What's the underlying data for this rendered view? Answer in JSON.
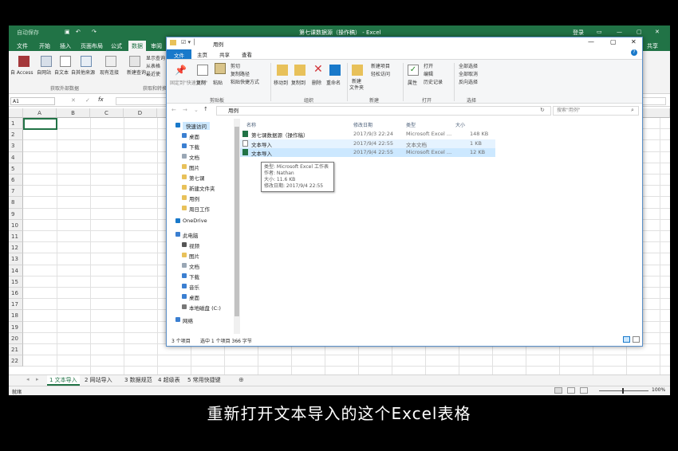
{
  "excel": {
    "qat_label": "自动保存",
    "title": "第七课数据源（操作稿） - Excel",
    "user": "登录",
    "share": "共享",
    "tabs": [
      "文件",
      "开始",
      "插入",
      "页面布局",
      "公式",
      "数据",
      "审阅"
    ],
    "active_tab": "数据",
    "ribbon": {
      "access": "自 Access",
      "web": "自网站",
      "text": "自文本",
      "other": "自其他来源",
      "existing": "现有连接",
      "new_query": "新建查询",
      "show_queries": "显示查询",
      "from_table": "从表格",
      "recent": "最近使",
      "group_external": "获取外部数据",
      "group_transform": "获取和转换"
    },
    "namebox": "A1",
    "formula_icons": [
      "✕",
      "✓",
      "fx"
    ],
    "columns": [
      "A",
      "B",
      "C",
      "D"
    ],
    "rows": [
      "1",
      "2",
      "3",
      "4",
      "5",
      "6",
      "7",
      "8",
      "9",
      "10",
      "11",
      "12",
      "13",
      "14",
      "15",
      "16",
      "17",
      "18",
      "19",
      "20",
      "21",
      "22"
    ],
    "sheets": [
      "1 文本导入",
      "2 网站导入",
      "3 数据规范",
      "4 超级表",
      "5 常用快捷键"
    ],
    "active_sheet": "1 文本导入",
    "status": "就绪",
    "zoom": "100%"
  },
  "explorer": {
    "title": "用例",
    "tabs": [
      "文件",
      "主页",
      "共享",
      "查看"
    ],
    "active_tab": "主页",
    "ribbon": {
      "pin": "固定到\"快速访问\"",
      "copy": "复制",
      "paste": "粘贴",
      "cut": "剪切",
      "copy_path": "复制路径",
      "paste_shortcut": "粘贴快捷方式",
      "move_to": "移动到",
      "copy_to": "复制到",
      "delete": "删除",
      "rename": "重命名",
      "new_folder": "新建\n文件夹",
      "new_item": "新建项目",
      "easy_access": "轻松访问",
      "properties": "属性",
      "open": "打开",
      "edit": "编辑",
      "history": "历史记录",
      "select_all": "全部选择",
      "select_none": "全部取消",
      "invert": "反向选择",
      "group_clipboard": "剪贴板",
      "group_organize": "组织",
      "group_new": "新建",
      "group_open": "打开",
      "group_select": "选择"
    },
    "address": "用例",
    "search_placeholder": "搜索\"用例\"",
    "nav": {
      "quick_access": "快速访问",
      "items": [
        "桌面",
        "下载",
        "文档",
        "图片",
        "第七课",
        "新建文件夹",
        "用例",
        "周日工作"
      ],
      "onedrive": "OneDrive",
      "this_pc": "此电脑",
      "pc_items": [
        "视频",
        "图片",
        "文档",
        "下载",
        "音乐",
        "桌面",
        "本地磁盘 (C:)"
      ],
      "network": "网络"
    },
    "columns": [
      "名称",
      "修改日期",
      "类型",
      "大小"
    ],
    "files": [
      {
        "name": "第七课数据源（操作稿）",
        "date": "2017/9/3 22:24",
        "type": "Microsoft Excel ...",
        "size": "148 KB",
        "icon": "excel"
      },
      {
        "name": "文本导入",
        "date": "2017/9/4 22:55",
        "type": "文本文档",
        "size": "1 KB",
        "icon": "text"
      },
      {
        "name": "文本导入",
        "date": "2017/9/4 22:55",
        "type": "Microsoft Excel ...",
        "size": "12 KB",
        "icon": "excel"
      }
    ],
    "tooltip": {
      "type": "类型: Microsoft Excel 工作表",
      "author": "作者: Nathan",
      "size": "大小: 11.6 KB",
      "modified": "修改日期: 2017/9/4 22:55"
    },
    "status_count": "3 个项目",
    "status_selected": "选中 1 个项目  366 字节"
  },
  "subtitle": "重新打开文本导入的这个Excel表格",
  "colors": {
    "excel_green": "#217346",
    "explorer_accent": "#1979ca",
    "selected_row": "#cce8ff"
  }
}
